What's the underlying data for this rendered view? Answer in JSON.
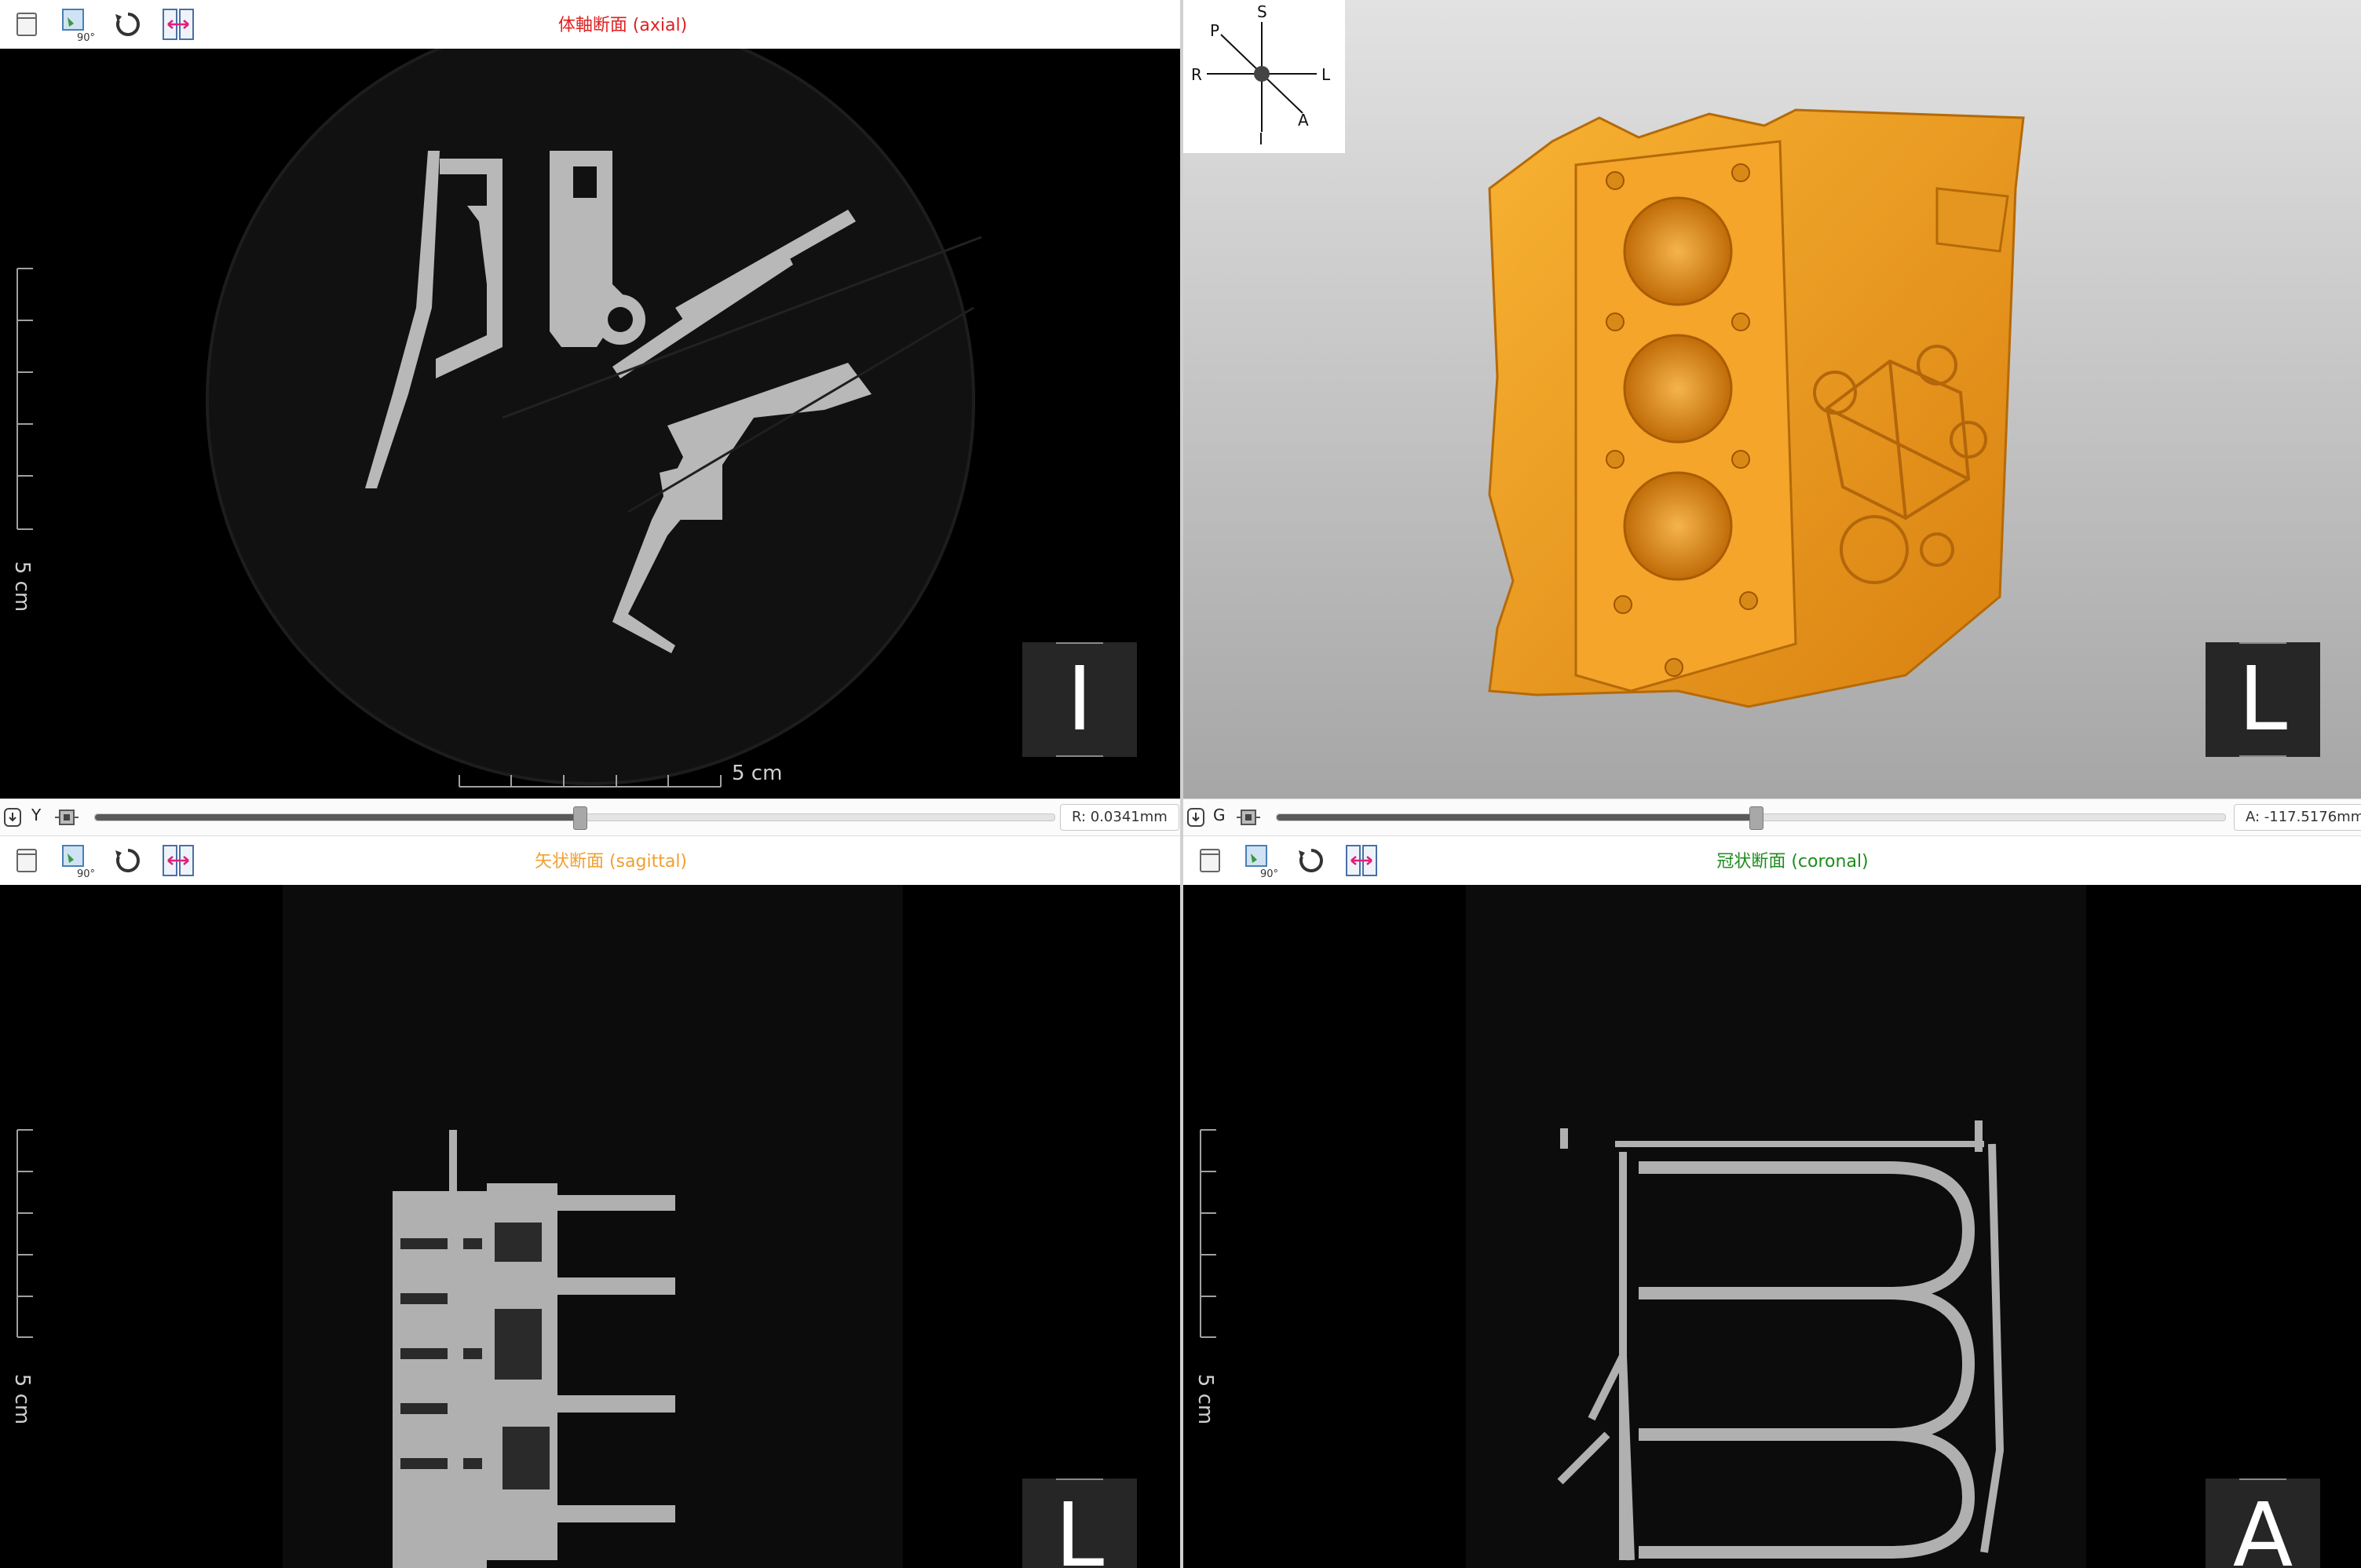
{
  "panes": {
    "axial": {
      "title": "体軸断面 (axial)",
      "title_color": "#e02020",
      "orientation": "I",
      "scale_label": "5 cm",
      "scale_label_bottom": "5 cm"
    },
    "render3d": {
      "orientation": "L"
    },
    "sagittal": {
      "title": "矢状断面 (sagittal)",
      "title_color": "#f0a030",
      "orientation": "L",
      "scale_label": "5 cm"
    },
    "coronal": {
      "title": "冠状断面 (coronal)",
      "title_color": "#1e8c1e",
      "orientation": "A",
      "scale_label": "5 cm"
    }
  },
  "sliders": {
    "left": {
      "axis": "Y",
      "value_text": "R: 0.0341mm",
      "position": 0.505
    },
    "right": {
      "axis": "G",
      "value_text": "A: -117.5176mm",
      "position": 0.505
    }
  },
  "compass": {
    "top": "S",
    "bottom": "I",
    "left": "R",
    "right": "L",
    "upper_left": "P",
    "lower_right": "A"
  },
  "toolbar_icons": [
    "window-icon",
    "rotate-90-icon",
    "reset-rotation-icon",
    "flip-horizontal-icon"
  ],
  "colors": {
    "model": "#f0a020",
    "background_3d_top": "#e2e2e2",
    "background_3d_bottom": "#a6a6a6"
  }
}
